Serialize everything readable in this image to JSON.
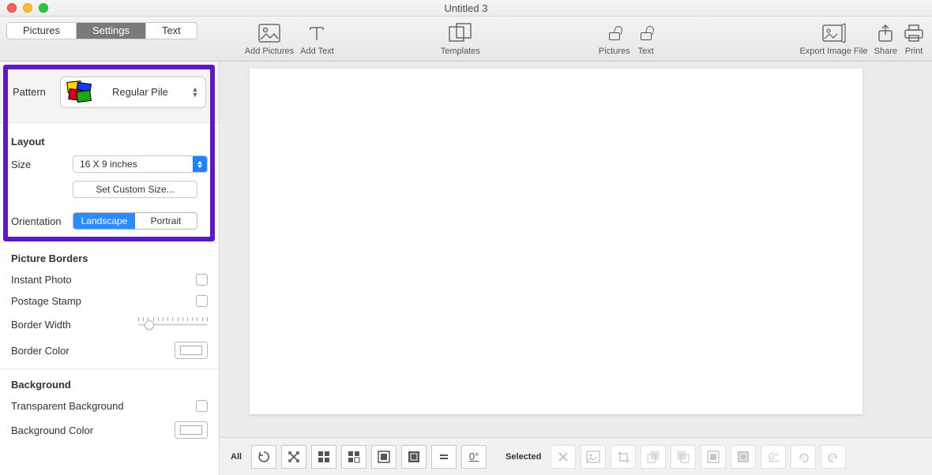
{
  "window": {
    "title": "Untitled 3"
  },
  "tabs": {
    "pictures": "Pictures",
    "settings": "Settings",
    "text": "Text"
  },
  "toolbar": {
    "add_pictures": "Add Pictures",
    "add_text": "Add Text",
    "templates": "Templates",
    "lock_pictures": "Pictures",
    "lock_text": "Text",
    "export": "Export Image File",
    "share": "Share",
    "print": "Print"
  },
  "pattern": {
    "label": "Pattern",
    "value": "Regular Pile"
  },
  "layout": {
    "title": "Layout",
    "size_label": "Size",
    "size_value": "16 X 9 inches",
    "custom_btn": "Set Custom Size...",
    "orientation_label": "Orientation",
    "landscape": "Landscape",
    "portrait": "Portrait"
  },
  "borders": {
    "title": "Picture Borders",
    "instant": "Instant Photo",
    "postage": "Postage Stamp",
    "width": "Border Width",
    "color": "Border Color"
  },
  "background": {
    "title": "Background",
    "transparent": "Transparent Background",
    "bgcolor": "Background Color"
  },
  "bottombar": {
    "all": "All",
    "selected": "Selected",
    "zero_deg": "0°"
  }
}
